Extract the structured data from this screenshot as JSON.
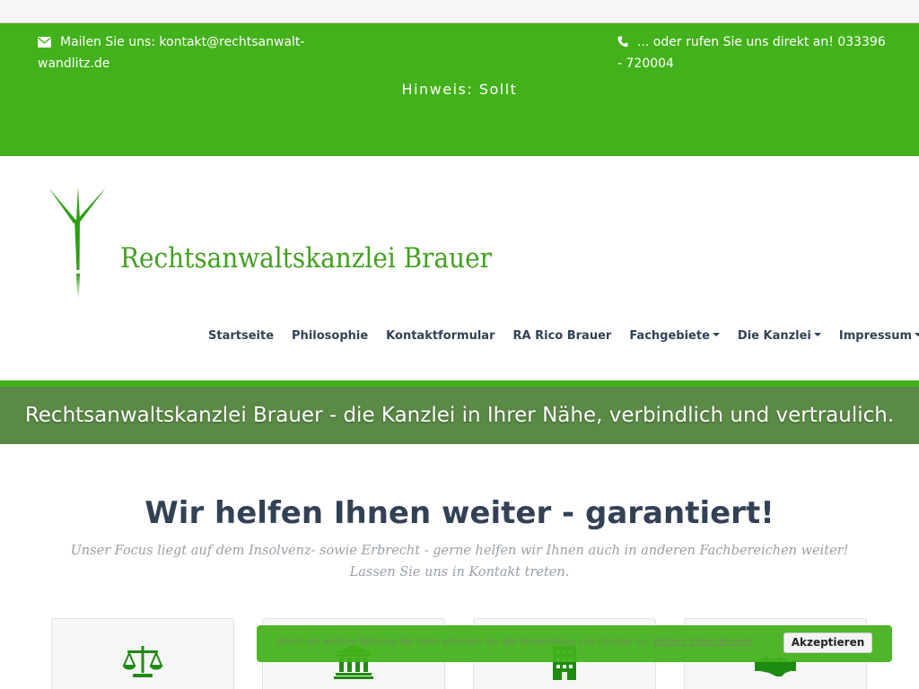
{
  "topbar": {
    "email_text": "Mailen Sie uns: kontakt@rechtsanwalt-wandlitz.de",
    "phone_text": "... oder rufen Sie uns direkt an! 033396 - 720004",
    "hint": "Hinweis: Sollt",
    "email_icon": "envelope-icon",
    "phone_icon": "phone-icon"
  },
  "brand": {
    "name": "Rechtsanwaltskanzlei Brauer",
    "logo_icon": "plant-sprout-logo"
  },
  "nav": {
    "items": [
      {
        "label": "Startseite"
      },
      {
        "label": "Philosophie"
      },
      {
        "label": "Kontaktformular"
      },
      {
        "label": "RA Rico Brauer"
      },
      {
        "label": "Fachgebiete"
      },
      {
        "label": "Die Kanzlei"
      },
      {
        "label": "Impressum"
      }
    ]
  },
  "banner": {
    "text": "Rechtsanwaltskanzlei Brauer - die Kanzlei in Ihrer Nähe, verbindlich und vertraulich."
  },
  "main": {
    "headline": "Wir helfen Ihnen weiter - garantiert!",
    "subtext": "Unser Focus liegt auf dem Insolvenz- sowie Erbrecht - gerne helfen wir Ihnen auch in anderen Fachbereichen weiter! Lassen Sie uns in Kontakt treten.",
    "cards": [
      {
        "icon": "scales-icon"
      },
      {
        "icon": "bank-building-icon"
      },
      {
        "icon": "office-building-icon"
      },
      {
        "icon": "handshake-icon"
      }
    ]
  },
  "cookie": {
    "text": "Durch die weitere Nutzung der Seite stimmen Sie der Verwendung von Cookies zu.",
    "link": "Weitere Informationen",
    "button": "Akzeptieren"
  },
  "colors": {
    "brand_green": "#43b11b",
    "banner_green": "#5a8a45",
    "logo_text_green": "#43a020",
    "nav_text": "#334155",
    "icon_green": "#1f8a12"
  }
}
